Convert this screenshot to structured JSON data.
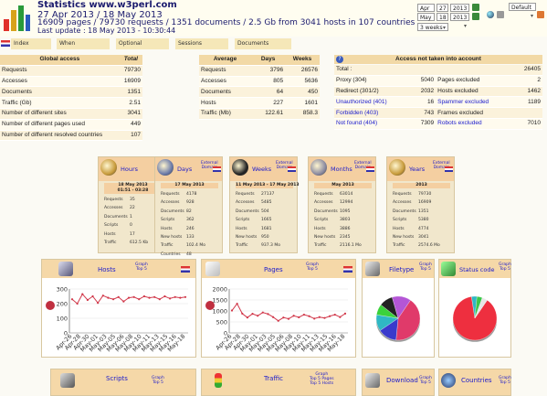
{
  "header": {
    "title": "Statistics www.w3perl.com",
    "date_range": "27 Apr 2013 / 18 May 2013",
    "summary": "16909 pages / 79730 requests / 1351 documents / 2.5 Gb from 3041 hosts in 107 countries",
    "last_update": "Last update : 18 May 2013 - 10:30:44",
    "from_month": "Apr",
    "from_day": "27",
    "from_year": "2013",
    "to_month": "May",
    "to_day": "18",
    "to_year": "2013",
    "period": "3 weeks",
    "theme": "Default"
  },
  "nav": [
    "Index",
    "When",
    "Optional",
    "Sessions",
    "Documents"
  ],
  "global_access": {
    "title": "Global access",
    "total_label": "Total",
    "rows": [
      {
        "label": "Requests",
        "value": "79730"
      },
      {
        "label": "Accesses",
        "value": "16909"
      },
      {
        "label": "Documents",
        "value": "1351"
      },
      {
        "label": "Traffic (Gb)",
        "value": "2.51"
      },
      {
        "label": "Number of different sites",
        "value": "3041"
      },
      {
        "label": "Number of different pages used",
        "value": "449"
      },
      {
        "label": "Number of different resolved countries",
        "value": "107"
      }
    ]
  },
  "average": {
    "headers": [
      "Average",
      "Days",
      "Weeks"
    ],
    "rows": [
      {
        "label": "Requests",
        "days": "3796",
        "weeks": "26576"
      },
      {
        "label": "Accesses",
        "days": "805",
        "weeks": "5636"
      },
      {
        "label": "Documents",
        "days": "64",
        "weeks": "450"
      },
      {
        "label": "Hosts",
        "days": "227",
        "weeks": "1601"
      },
      {
        "label": "Traffic (Mb)",
        "days": "122.61",
        "weeks": "858.3"
      }
    ]
  },
  "not_taken": {
    "title": "Access not taken into account",
    "total_label": "Total :",
    "total_value": "26405",
    "rows": [
      {
        "l1": "Proxy (304)",
        "v1": "5040",
        "l2": "Pages excluded",
        "v2": "2",
        "link1": false,
        "link2": false
      },
      {
        "l1": "Redirect (301/2)",
        "v1": "2032",
        "l2": "Hosts excluded",
        "v2": "1462",
        "link1": false,
        "link2": false
      },
      {
        "l1": "Unauthorized (401)",
        "v1": "16",
        "l2": "Spammer excluded",
        "v2": "1189",
        "link1": true,
        "link2": true
      },
      {
        "l1": "Forbidden (403)",
        "v1": "743",
        "l2": "Frames excluded",
        "v2": "",
        "link1": true,
        "link2": false
      },
      {
        "l1": "Not found (404)",
        "v1": "7309",
        "l2": "Robots excluded",
        "v2": "7010",
        "link1": true,
        "link2": true
      }
    ]
  },
  "periods": [
    {
      "title": "Hours",
      "ext": "",
      "date": "18 May 2013\n01:51 - 03:28",
      "stats": [
        [
          "Requests",
          "35"
        ],
        [
          "Accesses",
          "22"
        ],
        [
          "Documents",
          "1"
        ],
        [
          "Scripts",
          "0"
        ],
        [
          "Hosts",
          "17"
        ],
        [
          "Traffic",
          "612.5 Kb"
        ]
      ]
    },
    {
      "title": "Days",
      "ext": "External\nDomain",
      "date": "17 May 2013",
      "stats": [
        [
          "Requests",
          "4178"
        ],
        [
          "Accesses",
          "928"
        ],
        [
          "Documents",
          "82"
        ],
        [
          "Scripts",
          "362"
        ],
        [
          "Hosts",
          "246"
        ],
        [
          "New hosts",
          "133"
        ],
        [
          "Traffic",
          "102.4 Mo"
        ],
        [
          "Countries",
          "48"
        ]
      ]
    },
    {
      "title": "Weeks",
      "ext": "External\nDomain",
      "date": "11 May 2013 - 17 May 2013",
      "stats": [
        [
          "Requests",
          "27137"
        ],
        [
          "Accesses",
          "5485"
        ],
        [
          "Documents",
          "504"
        ],
        [
          "Scripts",
          "1665"
        ],
        [
          "Hosts",
          "1681"
        ],
        [
          "New hosts",
          "950"
        ],
        [
          "Traffic",
          "937.3 Mo"
        ]
      ]
    },
    {
      "title": "Months",
      "ext": "External\nDomain",
      "date": "May 2013",
      "stats": [
        [
          "Requests",
          "63014"
        ],
        [
          "Accesses",
          "12994"
        ],
        [
          "Documents",
          "1095"
        ],
        [
          "Scripts",
          "3803"
        ],
        [
          "Hosts",
          "3886"
        ],
        [
          "New hosts",
          "2345"
        ],
        [
          "Traffic",
          "2116.1 Mo"
        ]
      ]
    },
    {
      "title": "Years",
      "ext": "External\nDomain",
      "date": "2013",
      "stats": [
        [
          "Requests",
          "79730"
        ],
        [
          "Accesses",
          "16909"
        ],
        [
          "Documents",
          "1351"
        ],
        [
          "Scripts",
          "5380"
        ],
        [
          "Hosts",
          "4774"
        ],
        [
          "New hosts",
          "3041"
        ],
        [
          "Traffic",
          "2574.6 Mo"
        ]
      ]
    }
  ],
  "graphs": {
    "hosts": {
      "title": "Hosts",
      "link": "Graph\nTop 5"
    },
    "pages": {
      "title": "Pages",
      "link": "Graph\nTop 5"
    },
    "filetype": {
      "title": "Filetype",
      "link": "Graph\nTop 5"
    },
    "status": {
      "title": "Status code",
      "link": "Graph\nTop 5"
    },
    "scripts": {
      "title": "Scripts",
      "link": "Graph\nTop 5"
    },
    "traffic": {
      "title": "Traffic",
      "link": "Graph\nTop 5 Pages\nTop 5 Hosts"
    },
    "download": {
      "title": "Download",
      "link": "Graph\nTop 5"
    },
    "countries": {
      "title": "Countries",
      "link": "Graph\nTop 5"
    }
  },
  "chart_data": [
    {
      "type": "line",
      "title": "Hosts",
      "xlabel": "",
      "ylabel": "",
      "x": [
        "Apr-26",
        "Apr-28",
        "Apr-30",
        "May-01",
        "May-03",
        "May-05",
        "May-06",
        "May-08",
        "May-10",
        "May-11",
        "May-13",
        "May-15",
        "May-16",
        "May-18"
      ],
      "ylim": [
        0,
        300
      ],
      "yticks": [
        0,
        100,
        200,
        300
      ],
      "values": [
        230,
        200,
        265,
        225,
        250,
        205,
        255,
        240,
        230,
        245,
        215,
        240,
        245,
        230,
        250,
        240,
        245,
        230,
        250,
        235,
        245,
        240,
        245
      ]
    },
    {
      "type": "line",
      "title": "Pages",
      "xlabel": "",
      "ylabel": "",
      "x": [
        "Apr-26",
        "Apr-28",
        "Apr-30",
        "May-01",
        "May-03",
        "May-05",
        "May-06",
        "May-08",
        "May-10",
        "May-11",
        "May-13",
        "May-15",
        "May-16",
        "May-18"
      ],
      "ylim": [
        0,
        2000
      ],
      "yticks": [
        0,
        500,
        1000,
        1500,
        2000
      ],
      "values": [
        1020,
        1330,
        880,
        700,
        870,
        780,
        930,
        860,
        720,
        550,
        700,
        640,
        780,
        710,
        830,
        760,
        650,
        720,
        680,
        760,
        830,
        720,
        880
      ]
    },
    {
      "type": "pie",
      "title": "Filetype",
      "values": [
        42,
        14,
        12,
        8,
        10,
        14
      ],
      "colors": [
        "#e03a6a",
        "#3a3acc",
        "#2fb8c4",
        "#3bd23b",
        "#222222",
        "#b456d6"
      ]
    },
    {
      "type": "pie",
      "title": "Status code",
      "values": [
        88,
        4,
        4,
        4
      ],
      "colors": [
        "#ee2f3f",
        "#2fb8c4",
        "#3ac84a",
        "#e6e6e6"
      ]
    }
  ]
}
